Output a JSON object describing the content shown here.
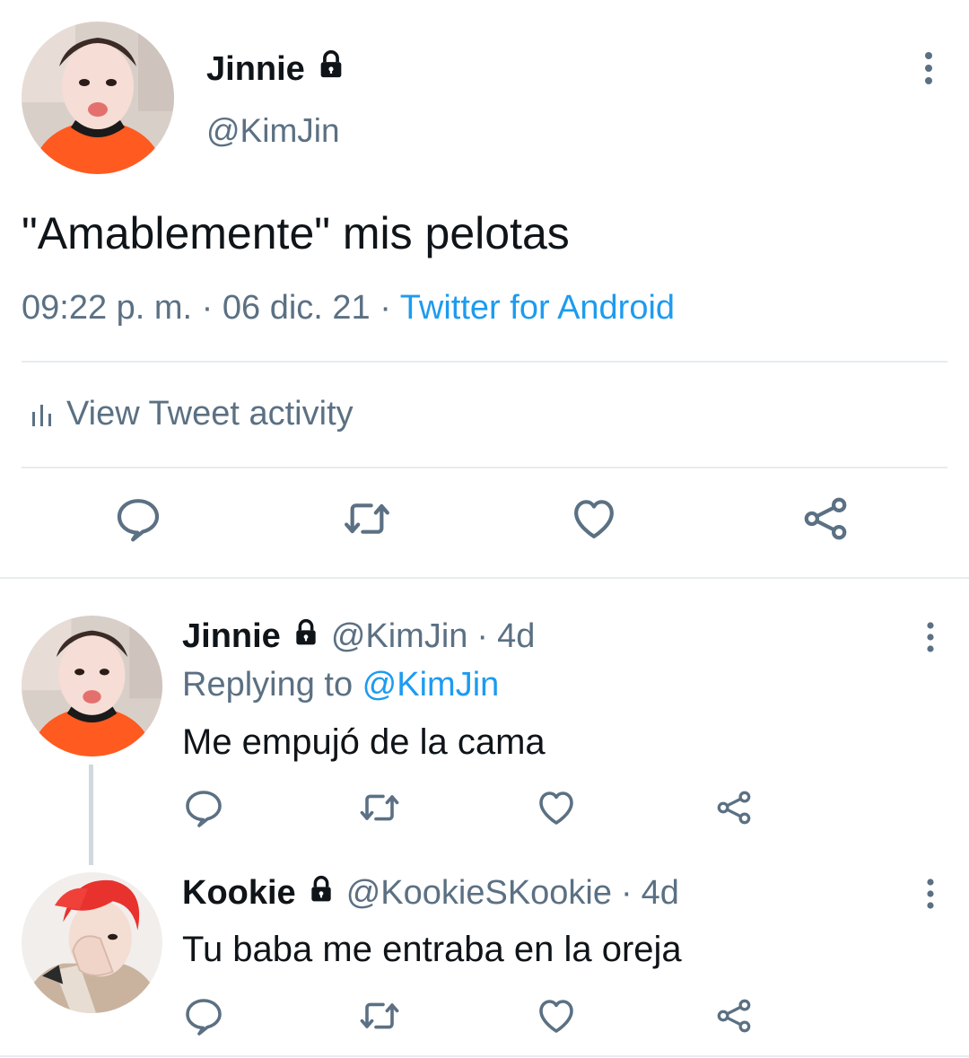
{
  "main_tweet": {
    "name": "Jinnie",
    "handle": "@KimJin",
    "text": "\"Amablemente\" mis pelotas",
    "time": "09:22 p. m.",
    "date": "06 dic. 21",
    "separator": " · ",
    "source": "Twitter for Android",
    "activity_label": "View Tweet activity",
    "locked": true
  },
  "replies": [
    {
      "name": "Jinnie",
      "handle": "@KimJin",
      "age": "4d",
      "dot": "·",
      "replying_prefix": "Replying to ",
      "replying_to": "@KimJin",
      "text": "Me empujó de la cama",
      "locked": true
    },
    {
      "name": "Kookie",
      "handle": "@KookieSKookie",
      "age": "4d",
      "dot": "·",
      "text": "Tu baba me entraba en la oreja",
      "locked": true
    }
  ],
  "icons": {
    "reply": "speech-bubble-icon",
    "retweet": "retweet-icon",
    "like": "heart-icon",
    "share": "share-icon",
    "more": "more-vertical-icon",
    "lock": "lock-icon",
    "activity": "bar-chart-icon"
  },
  "colors": {
    "text": "#0f1419",
    "secondary": "#5b7083",
    "link": "#1d9bf0",
    "divider": "#e6ecf0"
  }
}
